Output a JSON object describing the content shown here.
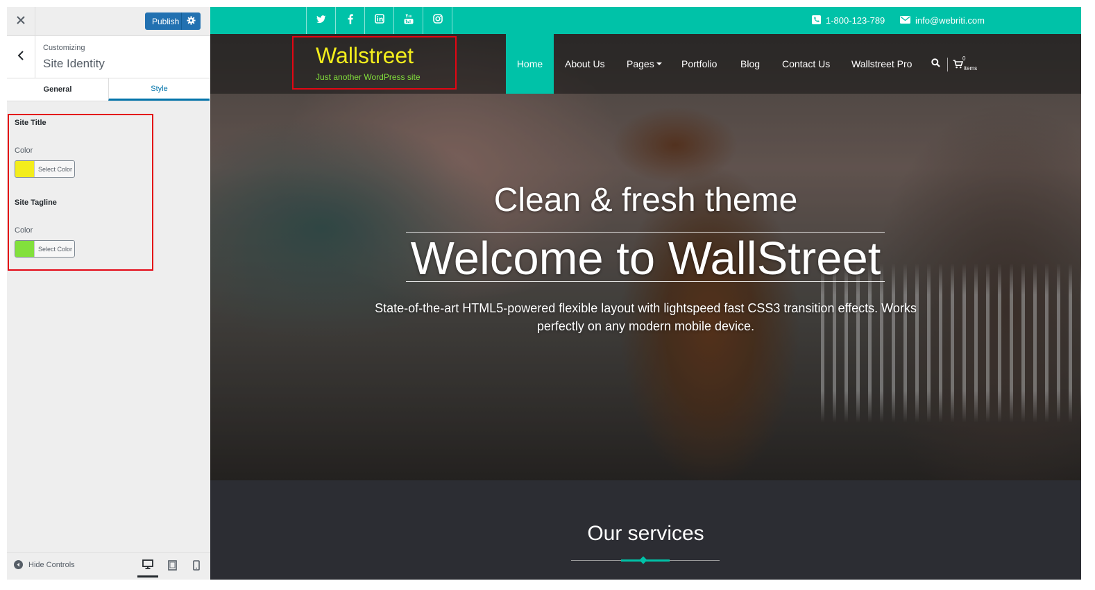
{
  "customizer": {
    "publish_label": "Publish",
    "breadcrumb": "Customizing",
    "section_title": "Site Identity",
    "tabs": [
      {
        "label": "General",
        "active": false
      },
      {
        "label": "Style",
        "active": true
      }
    ],
    "controls": {
      "site_title": {
        "heading": "Site Title",
        "color_label": "Color",
        "button_label": "Select Color",
        "color": "#f3ed1c"
      },
      "site_tagline": {
        "heading": "Site Tagline",
        "color_label": "Color",
        "button_label": "Select Color",
        "color": "#82e03c"
      }
    },
    "footer": {
      "hide_controls_label": "Hide Controls",
      "devices": [
        "desktop-icon",
        "tablet-icon",
        "mobile-icon"
      ],
      "active_device": "desktop"
    }
  },
  "site": {
    "topbar": {
      "social_icons": [
        "twitter-icon",
        "facebook-icon",
        "linkedin-icon",
        "youtube-icon",
        "instagram-icon"
      ],
      "phone": "1-800-123-789",
      "email": "info@webriti.com"
    },
    "brand": {
      "title": "Wallstreet",
      "tagline": "Just another WordPress site"
    },
    "nav": {
      "home": "Home",
      "about": "About Us",
      "pages": "Pages",
      "portfolio": "Portfolio",
      "blog": "Blog",
      "contact": "Contact Us",
      "pro": "Wallstreet Pro",
      "cart_count": "0",
      "cart_label": "items"
    },
    "hero": {
      "subtitle": "Clean & fresh theme",
      "title": "Welcome to WallStreet",
      "description": "State-of-the-art HTML5-powered flexible layout with lightspeed fast CSS3 transition effects. Works perfectly on any modern mobile device."
    },
    "services": {
      "title": "Our services"
    }
  },
  "colors": {
    "accent": "#00c2a8",
    "wp_blue": "#2271b1",
    "highlight_border": "#e30613"
  }
}
